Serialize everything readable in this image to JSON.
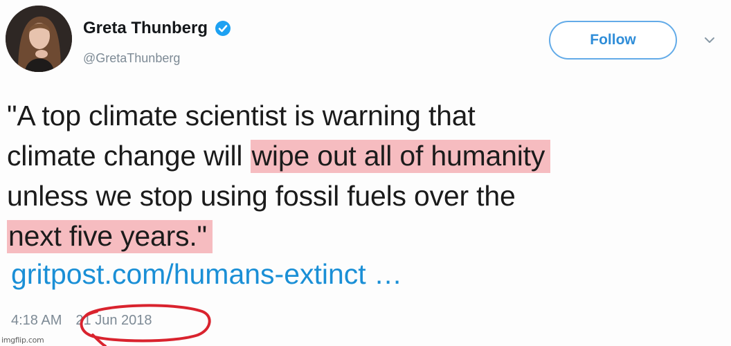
{
  "author": {
    "display_name": "Greta Thunberg",
    "handle": "@GretaThunberg",
    "avatar_icon": "person-portrait",
    "verified_icon": "verified-badge-icon"
  },
  "follow_button": {
    "label": "Follow"
  },
  "menu_icon": "chevron-down-icon",
  "tweet": {
    "lines": [
      {
        "plain": "\"A top climate scientist is warning that",
        "highlight": ""
      },
      {
        "plain": "climate change will ",
        "highlight": "wipe out all of humanity"
      },
      {
        "plain": "unless we stop using fossil fuels over the",
        "highlight": ""
      },
      {
        "plain": "",
        "highlight": "next five years.\""
      }
    ],
    "link": "gritpost.com/humans-extinct …"
  },
  "timestamp": {
    "time": "4:18 AM",
    "date": "21 Jun 2018"
  },
  "watermark": "imgflip.com",
  "colors": {
    "highlight": "#f6bcc0",
    "link": "#1a8fd6",
    "follow_border": "#63abe8",
    "annotation_circle": "#d9232e",
    "verified": "#1da1f2"
  }
}
